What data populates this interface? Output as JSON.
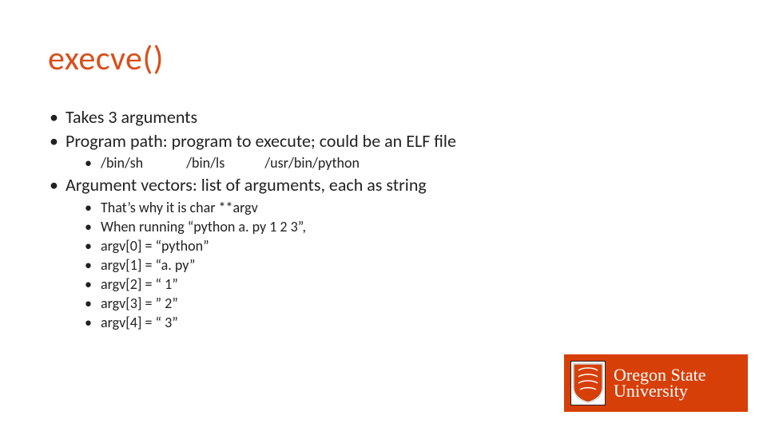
{
  "title": "execve()",
  "bullets": {
    "b1": "Takes 3 arguments",
    "b2": "Program path: program to execute; could be an ELF file",
    "b2_sub": {
      "a": "/bin/sh",
      "b": "/bin/ls",
      "c": "/usr/bin/python"
    },
    "b3": "Argument vectors: list of arguments, each as string",
    "b3_sub": {
      "a": "That’s why it is char **argv",
      "b": "When running “python a. py 1 2 3”,",
      "c": "argv[0] = “python”",
      "d": "argv[1] = “a. py”",
      "e": "argv[2] = “ 1”",
      "f": "argv[3] = ” 2”",
      "g": "argv[4] = “ 3”"
    }
  },
  "logo": {
    "line1": "Oregon State",
    "line2": "University"
  }
}
